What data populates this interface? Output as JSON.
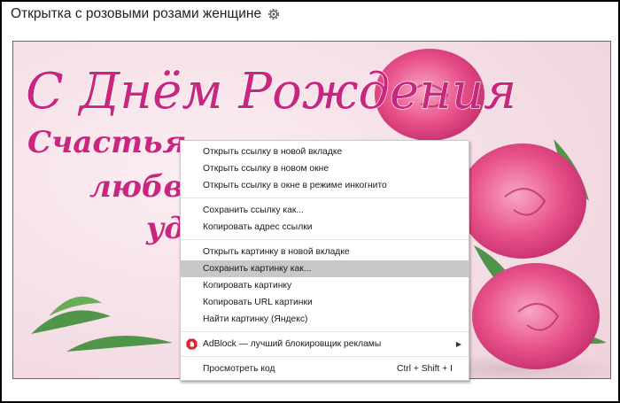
{
  "page": {
    "title": "Открытка с розовыми розами женщине",
    "settings_icon": "gear-icon"
  },
  "card": {
    "headline": "С Днём Рождения",
    "line1": "Счастья",
    "line2": "любв",
    "line3": "уд",
    "colors": {
      "background": "#f5dfe5",
      "text": "#c8267f",
      "rose": "#e8508a"
    }
  },
  "context_menu": {
    "items": [
      {
        "label": "Открыть ссылку в новой вкладке"
      },
      {
        "label": "Открыть ссылку в новом окне"
      },
      {
        "label": "Открыть ссылку в окне в режиме инкогнито"
      },
      {
        "label": "Сохранить ссылку как..."
      },
      {
        "label": "Копировать адрес ссылки"
      },
      {
        "label": "Открыть картинку в новой вкладке"
      },
      {
        "label": "Сохранить картинку как...",
        "highlighted": true
      },
      {
        "label": "Копировать картинку"
      },
      {
        "label": "Копировать URL картинки"
      },
      {
        "label": "Найти картинку (Яндекс)"
      },
      {
        "label": "AdBlock — лучший блокировщик рекламы",
        "icon": "adblock-icon",
        "submenu": true
      },
      {
        "label": "Просмотреть код",
        "shortcut": "Ctrl + Shift + I"
      }
    ]
  }
}
